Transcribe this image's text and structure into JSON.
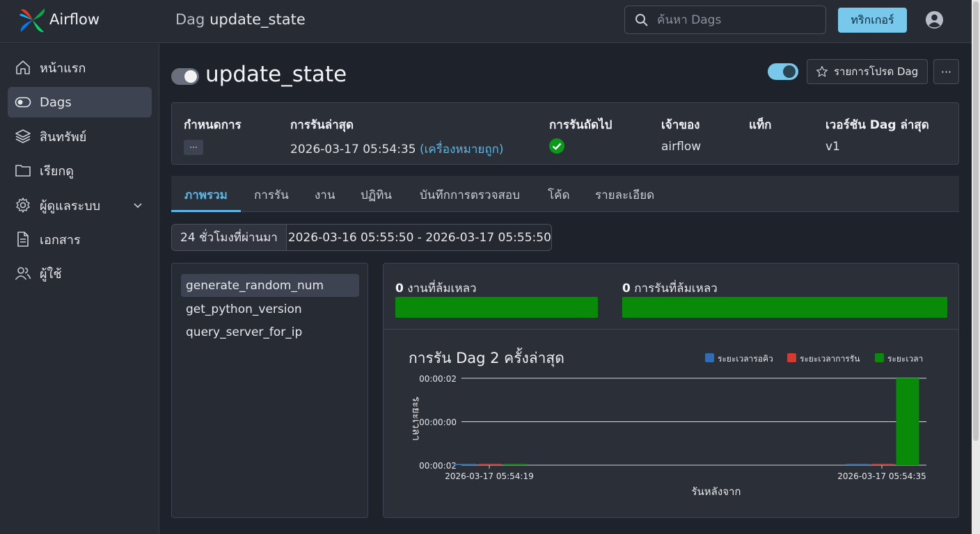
{
  "header": {
    "brand": "Airflow",
    "title_prefix": "Dag",
    "title_name": "update_state",
    "search_placeholder": "ค้นหา Dags",
    "trigger_label": "ทริกเกอร์"
  },
  "sidebar": {
    "items": [
      {
        "label": "หน้าแรก",
        "icon": "home-icon"
      },
      {
        "label": "Dags",
        "icon": "dag-toggle-icon",
        "active": true
      },
      {
        "label": "สินทรัพย์",
        "icon": "layers-icon"
      },
      {
        "label": "เรียกดู",
        "icon": "folder-icon"
      },
      {
        "label": "ผู้ดูแลระบบ",
        "icon": "gear-icon"
      },
      {
        "label": "เอกสาร",
        "icon": "document-icon"
      },
      {
        "label": "ผู้ใช้",
        "icon": "users-icon"
      }
    ]
  },
  "dag": {
    "name": "update_state",
    "favorite_label": "รายการโปรด Dag",
    "more_label": "···"
  },
  "info": {
    "schedule_label": "กำหนดการ",
    "schedule_value": "···",
    "last_run_label": "การรันล่าสุด",
    "last_run_value": "2026-03-17 05:54:35",
    "last_run_type": "(เครื่องหมายถูก)",
    "next_run_label": "การรันถัดไป",
    "owner_label": "เจ้าของ",
    "owner_value": "airflow",
    "tags_label": "แท็ก",
    "version_label": "เวอร์ชัน Dag ล่าสุด",
    "version_value": "v1"
  },
  "tabs": [
    "ภาพรวม",
    "การรัน",
    "งาน",
    "ปฏิทิน",
    "บันทึกการตรวจสอบ",
    "โค้ด",
    "รายละเอียด"
  ],
  "range": {
    "label": "24 ชั่วโมงที่ผ่านมา",
    "value": "2026-03-16 05:55:50 - 2026-03-17 05:55:50"
  },
  "tasks": [
    "generate_random_num",
    "get_python_version",
    "query_server_for_ip"
  ],
  "stats": {
    "failed_tasks_count": "0",
    "failed_tasks_label": "งานที่ล้มเหลว",
    "failed_runs_count": "0",
    "failed_runs_label": "การรันที่ล้มเหลว",
    "bar_color": "#098a09"
  },
  "chart_data": {
    "type": "bar",
    "title": "การรัน Dag 2 ครั้งล่าสุด",
    "xlabel": "รันหลังจาก",
    "ylabel": "ระยะเวลา",
    "y_ticks": [
      "00:00:02",
      "00:00:00",
      "00:00:02"
    ],
    "categories": [
      "2026-03-17 05:54:19",
      "2026-03-17 05:54:35"
    ],
    "series": [
      {
        "name": "ระยะเวลารอคิว",
        "color": "#2f6db5",
        "values": [
          0,
          0
        ]
      },
      {
        "name": "ระยะเวลาการรัน",
        "color": "#d63a2f",
        "values": [
          0,
          0
        ]
      },
      {
        "name": "ระยะเวลา",
        "color": "#098a09",
        "values": [
          0,
          2
        ]
      }
    ],
    "legend": "top-right",
    "grid": true
  }
}
